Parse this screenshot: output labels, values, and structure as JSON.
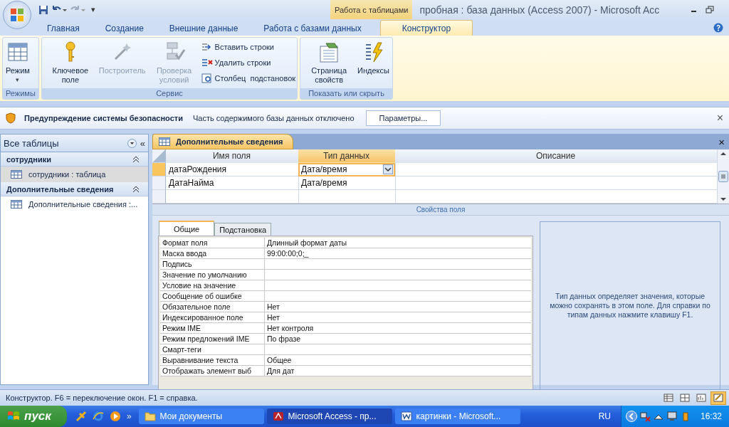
{
  "title_bar": {
    "context_tab": "Работа с таблицами",
    "title": "пробная : база данных (Access 2007) - Microsoft Acc",
    "qat_more": "▾"
  },
  "ribbon_tabs": [
    {
      "label": "Главная",
      "selected": false
    },
    {
      "label": "Создание",
      "selected": false
    },
    {
      "label": "Внешние данные",
      "selected": false
    },
    {
      "label": "Работа с базами данных",
      "selected": false
    },
    {
      "label": "Конструктор",
      "selected": true
    }
  ],
  "ribbon_groups": [
    {
      "label": "Режимы",
      "buttons": [
        {
          "label": "Режим",
          "kind": "large",
          "disabled": false,
          "caret": "▾"
        }
      ]
    },
    {
      "label": "Сервис",
      "buttons": [
        {
          "label": "Ключевое поле",
          "kind": "large",
          "disabled": false
        },
        {
          "label": "Построитель",
          "kind": "large",
          "disabled": true
        },
        {
          "label": "Проверка условий",
          "kind": "large",
          "disabled": true
        },
        {
          "label": "Вставить строки",
          "kind": "small",
          "disabled": false
        },
        {
          "label": "Удалить строки",
          "kind": "small",
          "disabled": false
        },
        {
          "label": "Столбец  подстановок",
          "kind": "small",
          "disabled": false
        }
      ]
    },
    {
      "label": "Показать или скрыть",
      "buttons": [
        {
          "label": "Страница свойств",
          "kind": "large",
          "disabled": false
        },
        {
          "label": "Индексы",
          "kind": "large",
          "disabled": false
        }
      ]
    }
  ],
  "security_bar": {
    "title": "Предупреждение системы безопасности",
    "message": "Часть содержимого базы данных отключено",
    "button": "Параметры...",
    "close": "×"
  },
  "navigation": {
    "header": "Все таблицы",
    "collapse": "«",
    "groups": [
      {
        "label": "сотрудники",
        "items": [
          {
            "label": "сотрудники : таблица",
            "selected": true
          }
        ]
      },
      {
        "label": "Дополнительные сведения",
        "items": [
          {
            "label": "Дополнительные сведения :...",
            "selected": false
          }
        ]
      }
    ]
  },
  "document_tab": {
    "label": "Дополнительные сведения",
    "close": "×"
  },
  "field_grid": {
    "columns": [
      "Имя поля",
      "Тип данных",
      "Описание"
    ],
    "rows": [
      {
        "name": "датаРождения",
        "type": "Дата/время",
        "description": "",
        "selected": true
      },
      {
        "name": "ДатаНайма",
        "type": "Дата/время",
        "description": "",
        "selected": false
      }
    ]
  },
  "field_properties": {
    "caption": "Свойства поля",
    "tabs": [
      {
        "label": "Общие",
        "selected": true
      },
      {
        "label": "Подстановка",
        "selected": false
      }
    ],
    "rows": [
      {
        "label": "Формат поля",
        "value": "Длинный формат даты"
      },
      {
        "label": "Маска ввода",
        "value": "99:00:00;0;_"
      },
      {
        "label": "Подпись",
        "value": ""
      },
      {
        "label": "Значение по умолчанию",
        "value": ""
      },
      {
        "label": "Условие на значение",
        "value": ""
      },
      {
        "label": "Сообщение об ошибке",
        "value": ""
      },
      {
        "label": "Обязательное поле",
        "value": "Нет"
      },
      {
        "label": "Индексированное поле",
        "value": "Нет"
      },
      {
        "label": "Режим IME",
        "value": "Нет контроля"
      },
      {
        "label": "Режим предложений IME",
        "value": "По фразе"
      },
      {
        "label": "Смарт-теги",
        "value": ""
      },
      {
        "label": "Выравнивание текста",
        "value": "Общее"
      },
      {
        "label": "Отображать элемент выб",
        "value": "Для дат"
      }
    ],
    "help": "Тип данных определяет значения, которые можно сохранять в этом поле.  Для справки по типам данных нажмите клавишу F1."
  },
  "status_bar": {
    "text": "Конструктор.  F6 = переключение окон.  F1 = справка.",
    "views": [
      {
        "selected": false
      },
      {
        "selected": false
      },
      {
        "selected": false
      },
      {
        "selected": true
      }
    ]
  },
  "taskbar": {
    "start": "пуск",
    "more": "»",
    "tasks": [
      {
        "label": "Мои документы",
        "selected": false
      },
      {
        "label": "Microsoft Access - пр...",
        "selected": true
      },
      {
        "label": "картинки - Microsoft...",
        "selected": false
      }
    ],
    "language": "RU",
    "clock": "16:32"
  }
}
